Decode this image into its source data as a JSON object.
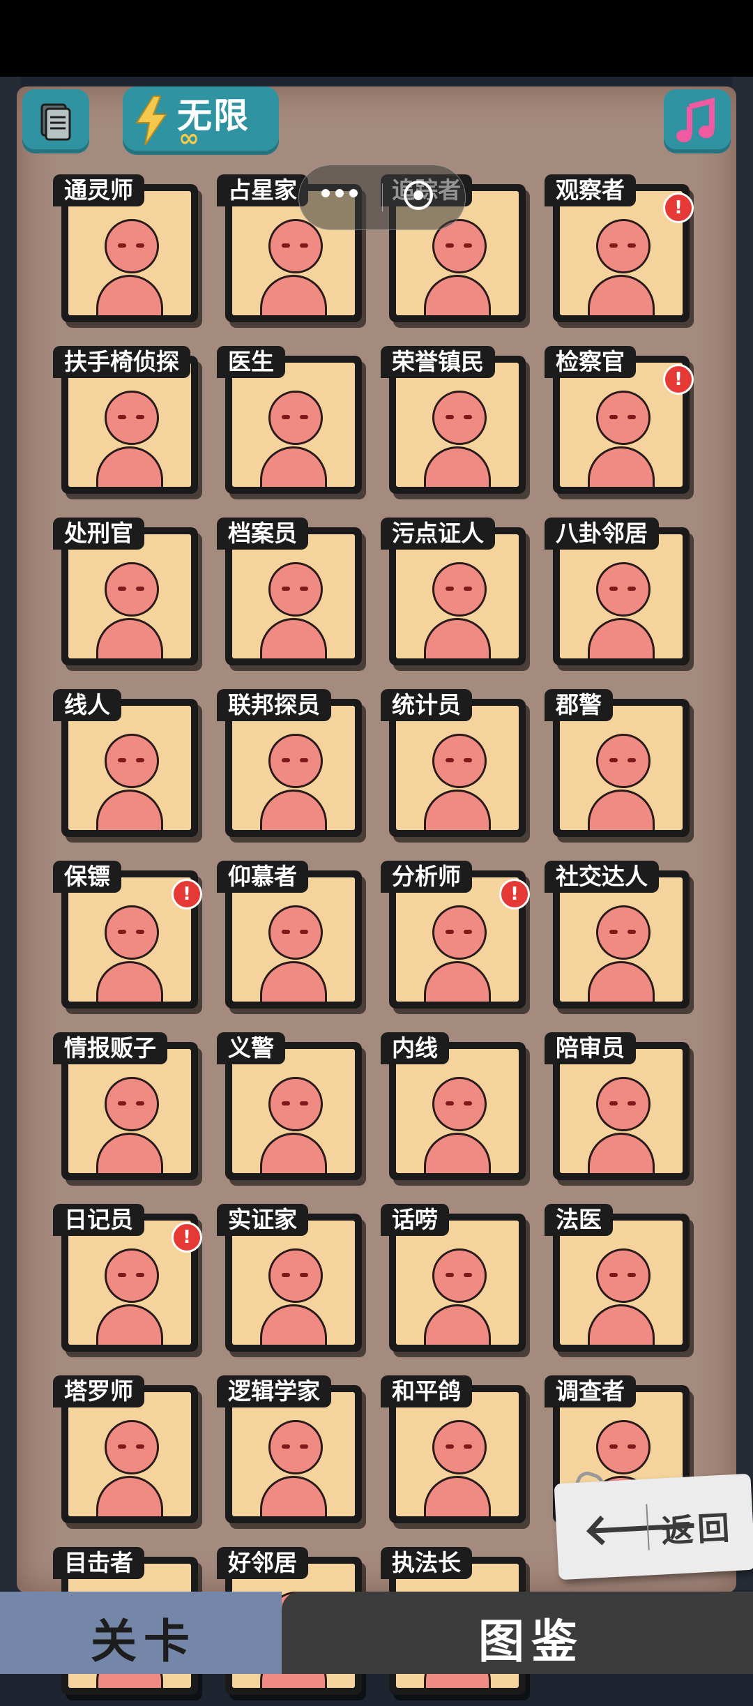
{
  "toolbar": {
    "menu_icon": "notebook-icon",
    "energy_label": "无限",
    "energy_sub": "∞",
    "music_icon": "music-note-icon"
  },
  "cards": [
    {
      "label": "通灵师",
      "alert": false
    },
    {
      "label": "占星家",
      "alert": false
    },
    {
      "label": "追踪者",
      "alert": false
    },
    {
      "label": "观察者",
      "alert": true
    },
    {
      "label": "扶手椅侦探",
      "alert": false
    },
    {
      "label": "医生",
      "alert": false
    },
    {
      "label": "荣誉镇民",
      "alert": false
    },
    {
      "label": "检察官",
      "alert": true
    },
    {
      "label": "处刑官",
      "alert": false
    },
    {
      "label": "档案员",
      "alert": false
    },
    {
      "label": "污点证人",
      "alert": false
    },
    {
      "label": "八卦邻居",
      "alert": false
    },
    {
      "label": "线人",
      "alert": false
    },
    {
      "label": "联邦探员",
      "alert": false
    },
    {
      "label": "统计员",
      "alert": false
    },
    {
      "label": "郡警",
      "alert": false
    },
    {
      "label": "保镖",
      "alert": true
    },
    {
      "label": "仰慕者",
      "alert": false
    },
    {
      "label": "分析师",
      "alert": true
    },
    {
      "label": "社交达人",
      "alert": false
    },
    {
      "label": "情报贩子",
      "alert": false
    },
    {
      "label": "义警",
      "alert": false
    },
    {
      "label": "内线",
      "alert": false
    },
    {
      "label": "陪审员",
      "alert": false
    },
    {
      "label": "日记员",
      "alert": true
    },
    {
      "label": "实证家",
      "alert": false
    },
    {
      "label": "话唠",
      "alert": false
    },
    {
      "label": "法医",
      "alert": false
    },
    {
      "label": "塔罗师",
      "alert": false
    },
    {
      "label": "逻辑学家",
      "alert": false
    },
    {
      "label": "和平鸽",
      "alert": false
    },
    {
      "label": "调查者",
      "alert": false
    },
    {
      "label": "目击者",
      "alert": false
    },
    {
      "label": "好邻居",
      "alert": false
    },
    {
      "label": "执法长",
      "alert": false
    }
  ],
  "alert_mark": "!",
  "back_button": {
    "label": "返回",
    "icon": "arrow-left-icon"
  },
  "tabs": [
    {
      "label": "关卡",
      "active": true
    },
    {
      "label": "图鉴",
      "active": false
    }
  ]
}
